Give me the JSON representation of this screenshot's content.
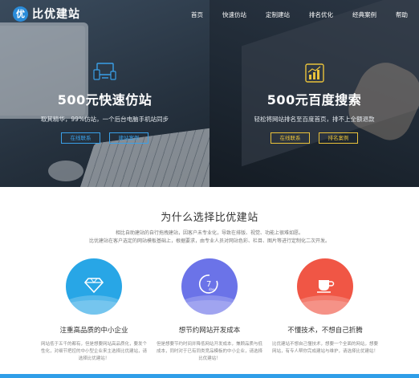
{
  "nav": {
    "logo_badge": "优",
    "logo_text": "比优建站",
    "links": [
      "首页",
      "快速仿站",
      "定制建站",
      "排名优化",
      "经典案例",
      "帮助"
    ]
  },
  "hero": {
    "left": {
      "title": "500元快速仿站",
      "subtitle": "取其精华，99%仿站，一个后台电脑手机站同步",
      "buttons": [
        "在线联系",
        "建站案例"
      ]
    },
    "right": {
      "title": "500元百度搜索",
      "subtitle": "轻松将网站排名至百度首页，排不上全额退款",
      "buttons": [
        "在线联系",
        "排名案例"
      ]
    }
  },
  "why": {
    "title": "为什么选择比优建站",
    "desc_line1": "相比自助建站的自行拖拽建站，因客户未专业化，导致在排版、视觉、功能上很难如愿。",
    "desc_line2": "比优建站在客户选定的网站模板基础上，根据要求，由专业人员对网站色彩、栏目、图片等进行定制化二次开发。",
    "features": [
      {
        "title": "注重高品质的中小企业",
        "text": "网站低于五千的都有，但是想要网站高品质化，要发个性化，对细节把控的中小型企业来主选择比优建站，请选择比优建站！"
      },
      {
        "title": "想节约网站开发成本",
        "text": "但是想要节约时间并降低网站开发成本，兼顾品质与低成本，同时对于已有同类竞品模板的中小企业，请选择比优建站！"
      },
      {
        "title": "不懂技术，不想自己折腾",
        "text": "比优建站不想自己懂技术，想要一个全面的网站，想要网站，有专人帮你完成建站与维护，请选择比优建站！"
      }
    ],
    "feature_icon_day": "7",
    "feature_icon_day_label": "day"
  },
  "colors": {
    "accent_blue": "#28a6e6",
    "accent_purple": "#6b73e8",
    "accent_red": "#f05645",
    "button_yellow": "#e9c23b"
  },
  "icons": [
    "devices-icon",
    "rising-chart-icon",
    "diamond-icon",
    "seven-day-clock-icon",
    "coffee-cup-icon"
  ]
}
